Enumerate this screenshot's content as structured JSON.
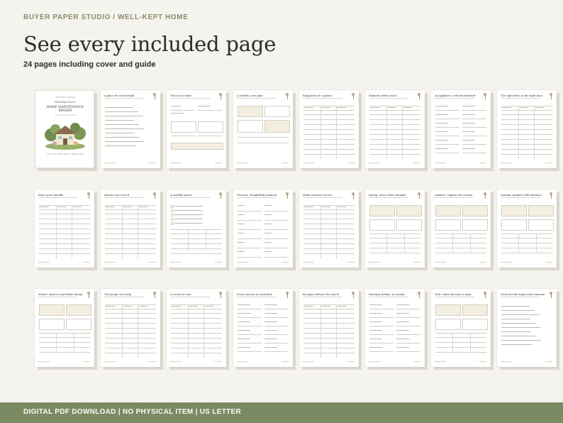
{
  "header": {
    "brand": "BUYER PAPER STUDIO  /  WELL-KEPT HOME",
    "headline": "See every included page",
    "subheadline": "24 pages including cover and guide"
  },
  "cover": {
    "kicker": "PRINTABLE PLANNER",
    "script_title": "Well-Kept Home",
    "title_line1": "HOME MAINTENANCE",
    "title_line2": "BINDER",
    "caption": "A year-round care record",
    "details": "WHAT YOU OWN  ·  WHEN IT NEEDS CARE"
  },
  "pages": [
    {
      "title": "",
      "layout": "cover"
    },
    {
      "title": "A place for every detail",
      "layout": "lines"
    },
    {
      "title": "This is our home",
      "layout": "form"
    },
    {
      "title": "A realistic care plan",
      "layout": "boxes"
    },
    {
      "title": "Equipment at a glance",
      "layout": "table"
    },
    {
      "title": "Manuals within reach",
      "layout": "table"
    },
    {
      "title": "An appliance, well documented",
      "layout": "fields"
    },
    {
      "title": "The right filter, at the right time",
      "layout": "table"
    },
    {
      "title": "Know your shutoffs",
      "layout": "table"
    },
    {
      "title": "Alarms care record",
      "layout": "table"
    },
    {
      "title": "A monthly pause",
      "layout": "checklist"
    },
    {
      "title": "The year, thoughtfully planned",
      "layout": "months"
    },
    {
      "title": "Make room for service",
      "layout": "table"
    },
    {
      "title": "Spring: notice what changed",
      "layout": "season"
    },
    {
      "title": "Summer: support the routine",
      "layout": "season"
    },
    {
      "title": "Autumn: prepare with intention",
      "layout": "season"
    },
    {
      "title": "Winter: observe and follow through",
      "layout": "season"
    },
    {
      "title": "The people who help",
      "layout": "table"
    },
    {
      "title": "A record of care",
      "layout": "table"
    },
    {
      "title": "From concern to resolution",
      "layout": "fields"
    },
    {
      "title": "Receipts without the search",
      "layout": "table"
    },
    {
      "title": "Warranty details, in context",
      "layout": "fields"
    },
    {
      "title": "Next, when the time is right",
      "layout": "season"
    },
    {
      "title": "Good records begin with someone",
      "layout": "lines"
    }
  ],
  "footer": {
    "text": "DIGITAL PDF DOWNLOAD   |   NO PHYSICAL ITEM   |   US LETTER"
  },
  "colors": {
    "background": "#f5f3ee",
    "footer_bar": "#7b8a63",
    "accent_beige": "#f3eedf",
    "text_dark": "#2d2d2a"
  }
}
